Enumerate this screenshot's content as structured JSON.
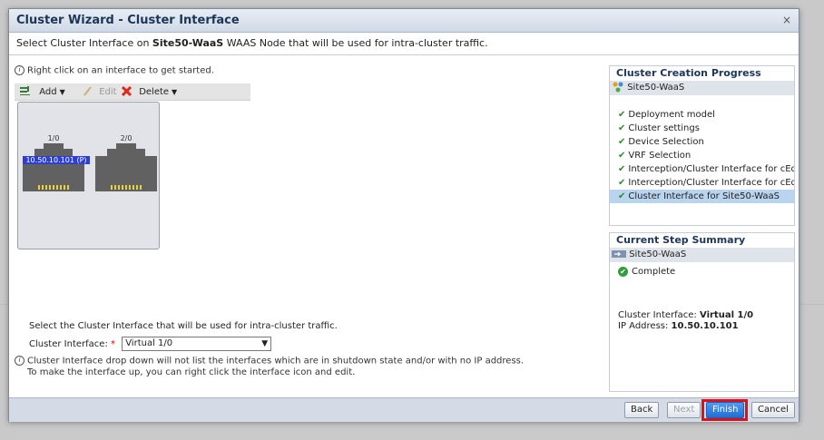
{
  "dialog": {
    "title": "Cluster Wizard - Cluster Interface",
    "close": "×",
    "subheader_pre": "Select Cluster Interface on ",
    "subheader_node": "Site50-WaaS",
    "subheader_post": " WAAS Node that will be used for intra-cluster traffic."
  },
  "left": {
    "hint": "Right click on an interface to get started.",
    "toolbar": {
      "add": "Add",
      "edit": "Edit",
      "delete": "Delete"
    },
    "ports": [
      {
        "name": "1/0",
        "label": "10.50.10.101 (P)"
      },
      {
        "name": "2/0"
      }
    ],
    "select_prompt": "Select the Cluster Interface that will be used for intra-cluster traffic.",
    "field_label": "Cluster Interface:",
    "required_mark": "*",
    "field_value": "Virtual 1/0",
    "note_line1": "Cluster Interface drop down will not list the interfaces which are in shutdown state and/or with no IP address.",
    "note_line2": "To make the interface up, you can right click the interface icon and edit."
  },
  "progress": {
    "title": "Cluster Creation Progress",
    "node": "Site50-WaaS",
    "steps": [
      "Deployment model",
      "Cluster settings",
      "Device Selection",
      "VRF Selection",
      "Interception/Cluster Interface for cEd...",
      "Interception/Cluster Interface for cEd...",
      "Cluster Interface for Site50-WaaS"
    ]
  },
  "summary": {
    "title": "Current Step Summary",
    "node": "Site50-WaaS",
    "status": "Complete",
    "ci_label": "Cluster Interface:",
    "ci_value": "Virtual 1/0",
    "ip_label": "IP Address:",
    "ip_value": "10.50.10.101"
  },
  "footer": {
    "back": "Back",
    "next": "Next",
    "finish": "Finish",
    "cancel": "Cancel"
  },
  "colors": {
    "highlight": "#e0101a",
    "accent": "#1e6fd6",
    "check": "#2e8b2e"
  }
}
